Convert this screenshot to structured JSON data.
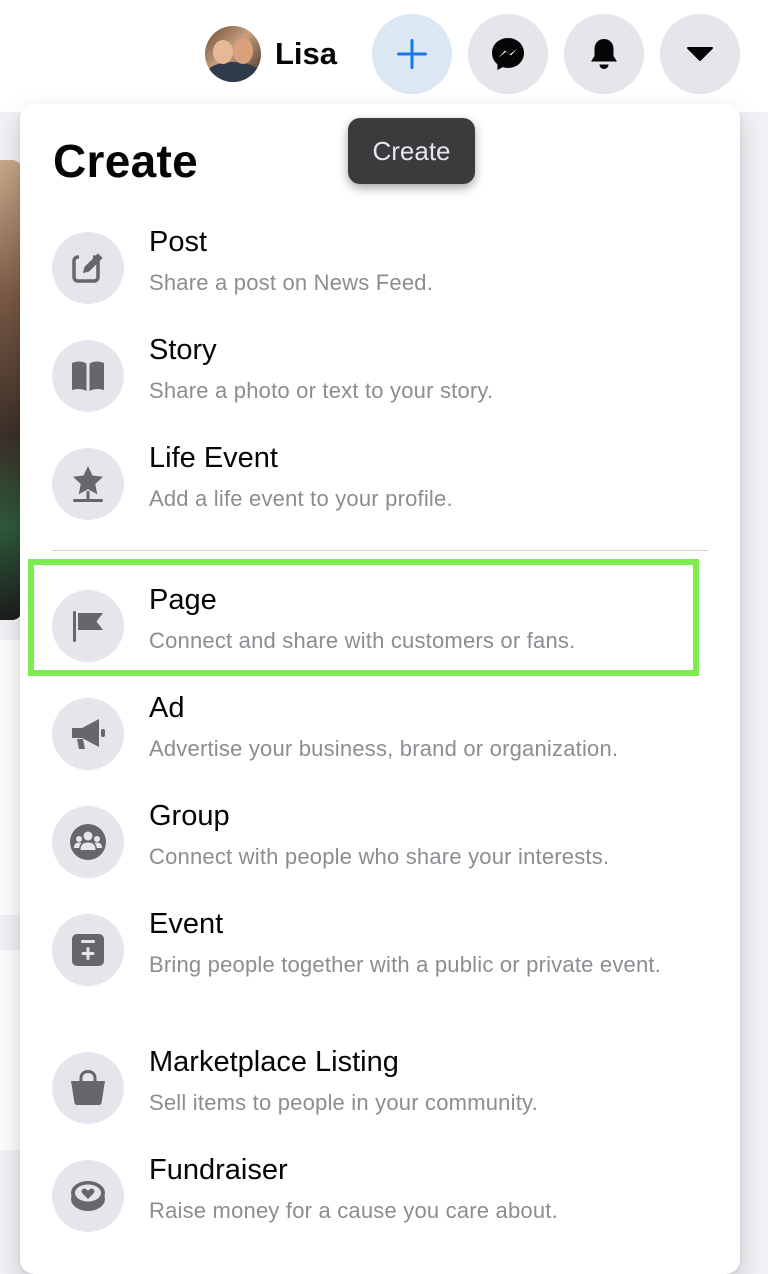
{
  "header": {
    "profile_name": "Lisa",
    "buttons": [
      {
        "name": "create",
        "icon": "plus-icon"
      },
      {
        "name": "messenger",
        "icon": "messenger-icon"
      },
      {
        "name": "notifications",
        "icon": "bell-icon"
      },
      {
        "name": "account",
        "icon": "caret-down-icon"
      }
    ]
  },
  "tooltip": {
    "text": "Create"
  },
  "menu": {
    "title": "Create",
    "items": [
      {
        "label": "Post",
        "description": "Share a post on News Feed.",
        "icon": "compose-icon"
      },
      {
        "label": "Story",
        "description": "Share a photo or text to your story.",
        "icon": "book-icon"
      },
      {
        "label": "Life Event",
        "description": "Add a life event to your profile.",
        "icon": "star-icon"
      },
      {
        "label": "Page",
        "description": "Connect and share with customers or fans.",
        "icon": "flag-icon"
      },
      {
        "label": "Ad",
        "description": "Advertise your business, brand or organization.",
        "icon": "megaphone-icon"
      },
      {
        "label": "Group",
        "description": "Connect with people who share your interests.",
        "icon": "group-icon"
      },
      {
        "label": "Event",
        "description": "Bring people together with a public or private event.",
        "icon": "calendar-plus-icon"
      },
      {
        "label": "Marketplace Listing",
        "description": "Sell items to people in your community.",
        "icon": "shopping-bag-icon"
      },
      {
        "label": "Fundraiser",
        "description": "Raise money for a cause you care about.",
        "icon": "heart-coin-icon"
      }
    ]
  },
  "colors": {
    "accent": "#1877f2",
    "icon_gray": "#65676b",
    "highlight": "#7dec4f"
  }
}
